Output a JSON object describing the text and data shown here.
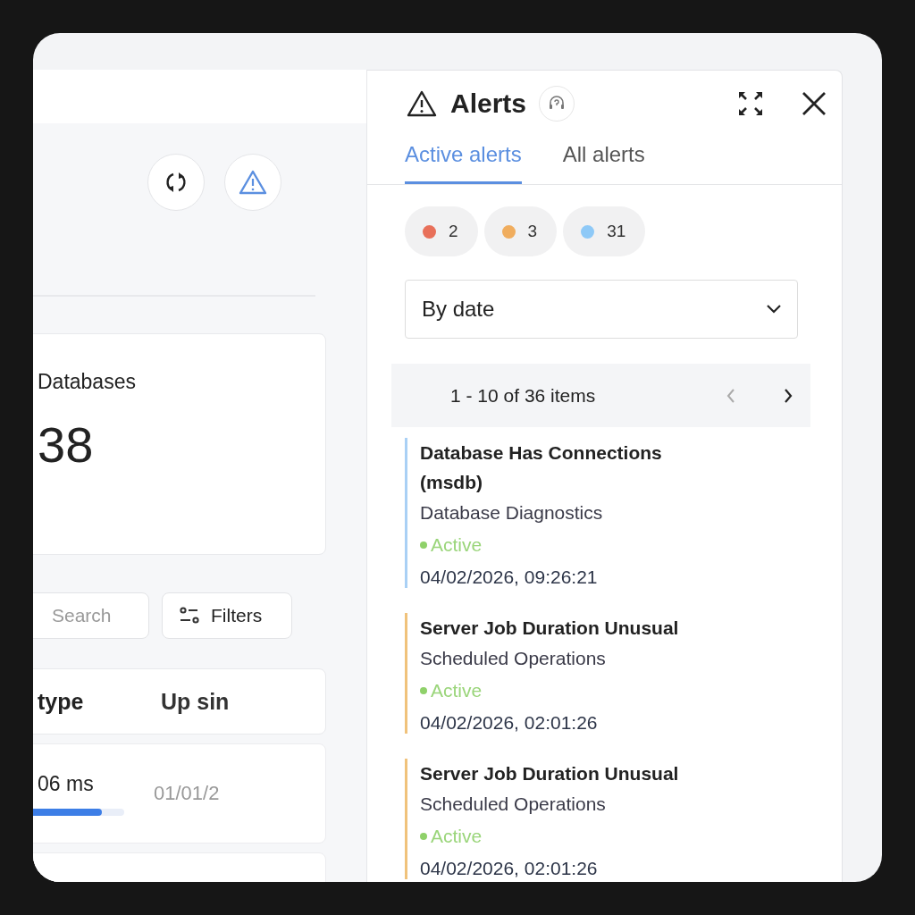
{
  "dashboard": {
    "toolbar_buttons": [
      {
        "kind": "refresh"
      },
      {
        "kind": "alert"
      }
    ],
    "stat_card": {
      "label": "Databases",
      "value": "38"
    },
    "search": {
      "placeholder": "Search"
    },
    "filters_button": {
      "label": "Filters"
    },
    "table": {
      "columns": [
        "type",
        "Up sin"
      ],
      "rows": [
        {
          "cells": [
            "06 ms",
            "01/01/2"
          ],
          "level": 0.8
        }
      ]
    }
  },
  "alerts_panel": {
    "title": "Alerts",
    "tabs": [
      {
        "label": "Active alerts",
        "selected": true
      },
      {
        "label": "All alerts",
        "selected": false
      }
    ],
    "counts": [
      {
        "label": "2",
        "color": "#e8705a"
      },
      {
        "label": "3",
        "color": "#f0ad5e"
      },
      {
        "label": "31",
        "color": "#8ec9f7"
      }
    ],
    "sort": {
      "value": "By date"
    },
    "pagination": {
      "range": "1 - 10 of 36 items"
    },
    "alerts": [
      {
        "title": "Database Has Connections (msdb)",
        "category": "Database Diagnostics",
        "status": "Active",
        "time": "04/02/2026, 09:26:21",
        "color": "#a9d0f5"
      },
      {
        "title": "Server Job Duration Unusual",
        "category": "Scheduled Operations",
        "status": "Active",
        "time": "04/02/2026, 02:01:26",
        "color": "#f0c27b"
      },
      {
        "title": "Server Job Duration Unusual",
        "category": "Scheduled Operations",
        "status": "Active",
        "time": "04/02/2026, 02:01:26",
        "color": "#f0c27b"
      }
    ]
  }
}
